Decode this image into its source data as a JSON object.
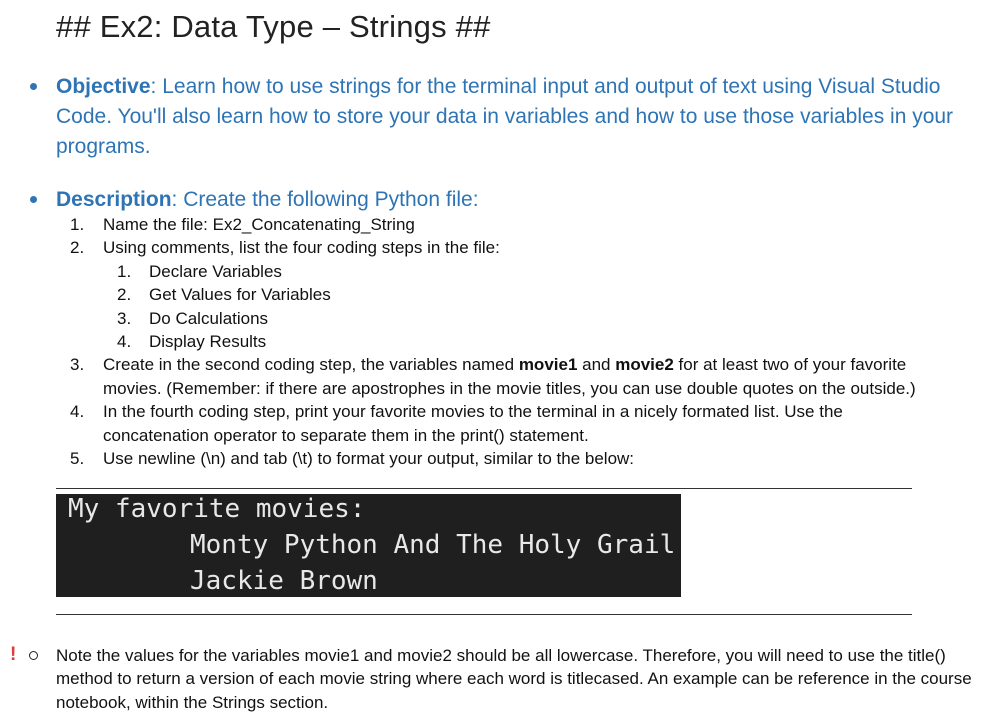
{
  "title": "## Ex2: Data Type – Strings ##",
  "objective": {
    "label": "Objective",
    "text": ": Learn how to use strings for the terminal input and output of text using Visual Studio Code.  You'll also learn how to store your data in variables and how to use those variables in your programs."
  },
  "description": {
    "label": "Description",
    "text": ": Create the following Python file:"
  },
  "steps": [
    {
      "num": "1.",
      "text": "Name the file: Ex2_Concatenating_String"
    },
    {
      "num": "2.",
      "text": "Using comments, list the four coding steps in the file:"
    },
    {
      "num": "3.",
      "pre": "Create in the second coding step, the variables named ",
      "b1": "movie1",
      "mid": " and ",
      "b2": "movie2",
      "post": " for at least two of your favorite movies. (Remember: if there are apostrophes in the movie titles, you can use double quotes on the outside.)"
    },
    {
      "num": "4.",
      "text": "In the fourth coding step, print your favorite movies to the terminal in a nicely formated list. Use the concatenation operator to separate them in the print() statement."
    },
    {
      "num": "5.",
      "text": "Use newline (\\n) and tab (\\t) to format your output, similar to the below:"
    }
  ],
  "substeps": [
    {
      "num": "1.",
      "text": "Declare Variables"
    },
    {
      "num": "2.",
      "text": "Get Values for Variables"
    },
    {
      "num": "3.",
      "text": "Do Calculations"
    },
    {
      "num": "4.",
      "text": "Display Results"
    }
  ],
  "terminal": {
    "line1": "My favorite movies:",
    "line2": "Monty Python And The Holy Grail",
    "line3": "Jackie Brown"
  },
  "note": {
    "warn_symbol": "!",
    "text": "Note the values for the variables movie1 and movie2 should be all lowercase.  Therefore, you will need to use the title() method to return a version of each movie string where each word is titlecased. An example can be reference in the course notebook, within the Strings section."
  },
  "colors": {
    "accent": "#2e74b5",
    "terminal_bg": "#1f1f1f"
  }
}
